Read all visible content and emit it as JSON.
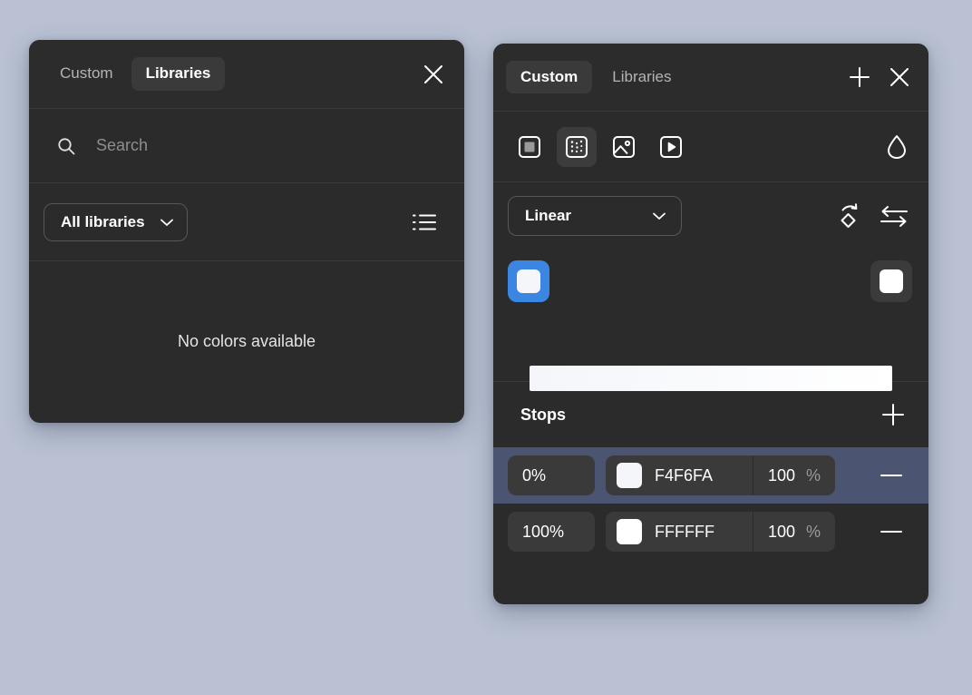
{
  "theme": {
    "page_background": "#B9C1D3",
    "panel_background": "#2B2B2B",
    "panel_header_background": "#2C2C2C",
    "accent_blue": "#3B86E2",
    "selected_row_background": "#4B5571",
    "field_background": "#3A3A3A"
  },
  "libraries_panel": {
    "tabs": [
      {
        "label": "Custom",
        "active": false
      },
      {
        "label": "Libraries",
        "active": true
      }
    ],
    "close_label": "Close",
    "search": {
      "placeholder": "Search",
      "value": "",
      "icon": "search-icon"
    },
    "filter": {
      "selected": "All libraries",
      "chevron": "chevron-down-icon",
      "view_toggle_icon": "list-view-icon"
    },
    "empty_message": "No colors available"
  },
  "custom_panel": {
    "tabs": [
      {
        "label": "Custom",
        "active": true
      },
      {
        "label": "Libraries",
        "active": false
      }
    ],
    "add_label": "Add",
    "close_label": "Close",
    "fill_types": [
      {
        "name": "solid-fill-icon",
        "label": "Solid",
        "selected": false
      },
      {
        "name": "gradient-fill-icon",
        "label": "Gradient",
        "selected": true
      },
      {
        "name": "image-fill-icon",
        "label": "Image",
        "selected": false
      },
      {
        "name": "video-fill-icon",
        "label": "Video",
        "selected": false
      }
    ],
    "eyedropper_icon": "droplet-icon",
    "gradient": {
      "type": "Linear",
      "chevron": "chevron-down-icon",
      "rotate_icon": "rotate-gradient-icon",
      "reverse_icon": "reverse-gradient-icon",
      "preview_from": "#F4F6FA",
      "preview_to": "#FFFFFF",
      "handles": [
        {
          "position_pct": 0,
          "color": "#F4F6FA",
          "selected": true
        },
        {
          "position_pct": 100,
          "color": "#FFFFFF",
          "selected": false
        }
      ]
    },
    "stops_section": {
      "title": "Stops",
      "add_stop_label": "Add stop",
      "rows": [
        {
          "position": "0%",
          "swatch": "#F4F6FA",
          "hex": "F4F6FA",
          "alpha": "100",
          "alpha_unit": "%",
          "selected": true,
          "remove_label": "Remove stop"
        },
        {
          "position": "100%",
          "swatch": "#FFFFFF",
          "hex": "FFFFFF",
          "alpha": "100",
          "alpha_unit": "%",
          "selected": false,
          "remove_label": "Remove stop"
        }
      ]
    }
  }
}
